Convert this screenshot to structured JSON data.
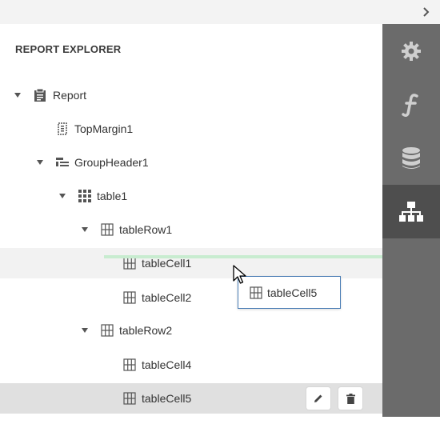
{
  "panel": {
    "title": "REPORT EXPLORER"
  },
  "tree": [
    {
      "label": "Report",
      "icon": "report-icon"
    },
    {
      "label": "TopMargin1",
      "icon": "margin-band-icon"
    },
    {
      "label": "GroupHeader1",
      "icon": "group-header-icon"
    },
    {
      "label": "table1",
      "icon": "table-icon"
    },
    {
      "label": "tableRow1",
      "icon": "table-row-icon"
    },
    {
      "label": "tableCell1",
      "icon": "table-cell-icon"
    },
    {
      "label": "tableCell2",
      "icon": "table-cell-icon"
    },
    {
      "label": "tableRow2",
      "icon": "table-row-icon"
    },
    {
      "label": "tableCell4",
      "icon": "table-cell-icon"
    },
    {
      "label": "tableCell5",
      "icon": "table-cell-icon"
    }
  ],
  "drag": {
    "label": "tableCell5"
  },
  "side_tabs": [
    {
      "name": "properties",
      "icon": "gear-icon"
    },
    {
      "name": "expressions",
      "icon": "function-icon"
    },
    {
      "name": "field-list",
      "icon": "database-icon"
    },
    {
      "name": "report-explorer",
      "icon": "hierarchy-icon",
      "active": true
    }
  ],
  "colors": {
    "sidebar": "#6b6b6b",
    "sidebar_active": "#4e4e4e",
    "drop_indicator": "#c8ecd0",
    "drag_border": "#4a7db5",
    "selected_row": "#e0e0e0"
  }
}
